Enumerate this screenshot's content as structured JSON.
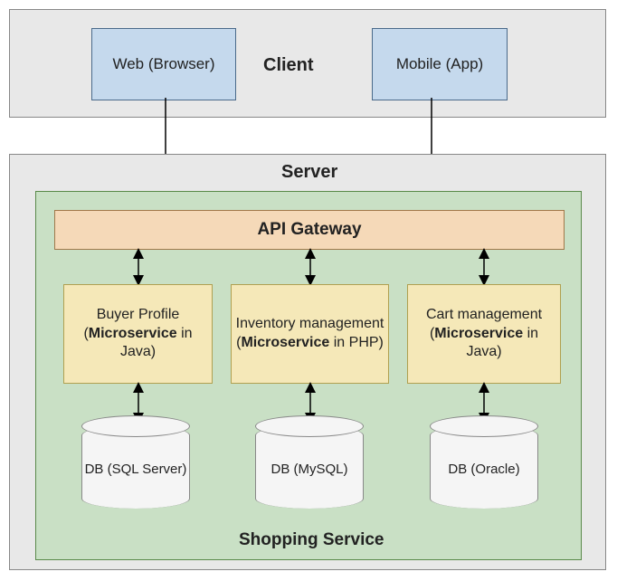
{
  "client": {
    "label": "Client",
    "web": "Web (Browser)",
    "mobile": "Mobile (App)"
  },
  "server": {
    "label": "Server",
    "shopping_label": "Shopping Service",
    "api_gateway": "API Gateway",
    "microservices": {
      "buyer_profile": {
        "title": "Buyer Profile",
        "tech_prefix": "(",
        "tech_bold": "Microservice",
        "tech_suffix": " in Java)"
      },
      "inventory": {
        "title": "Inventory management",
        "tech_prefix": "(",
        "tech_bold": "Microservice",
        "tech_suffix": " in PHP)"
      },
      "cart": {
        "title": "Cart management",
        "tech_prefix": "(",
        "tech_bold": "Microservice",
        "tech_suffix": " in Java)"
      }
    },
    "databases": {
      "db1": "DB (SQL Server)",
      "db2": "DB (MySQL)",
      "db3": "DB (Oracle)"
    }
  }
}
